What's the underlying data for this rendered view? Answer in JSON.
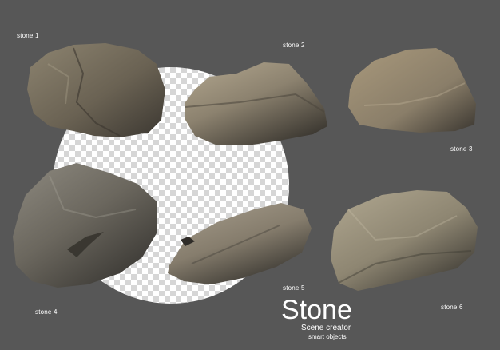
{
  "labels": {
    "stone1": "stone 1",
    "stone2": "stone 2",
    "stone3": "stone 3",
    "stone4": "stone 4",
    "stone5": "stone 5",
    "stone6": "stone 6"
  },
  "brand": {
    "title": "Stone",
    "subtitle": "Scene creator",
    "tagline": "smart objects"
  },
  "colors": {
    "background": "#575757",
    "stone_light": "#9b907c",
    "stone_mid": "#7a705f",
    "stone_dark": "#3f3a33"
  }
}
